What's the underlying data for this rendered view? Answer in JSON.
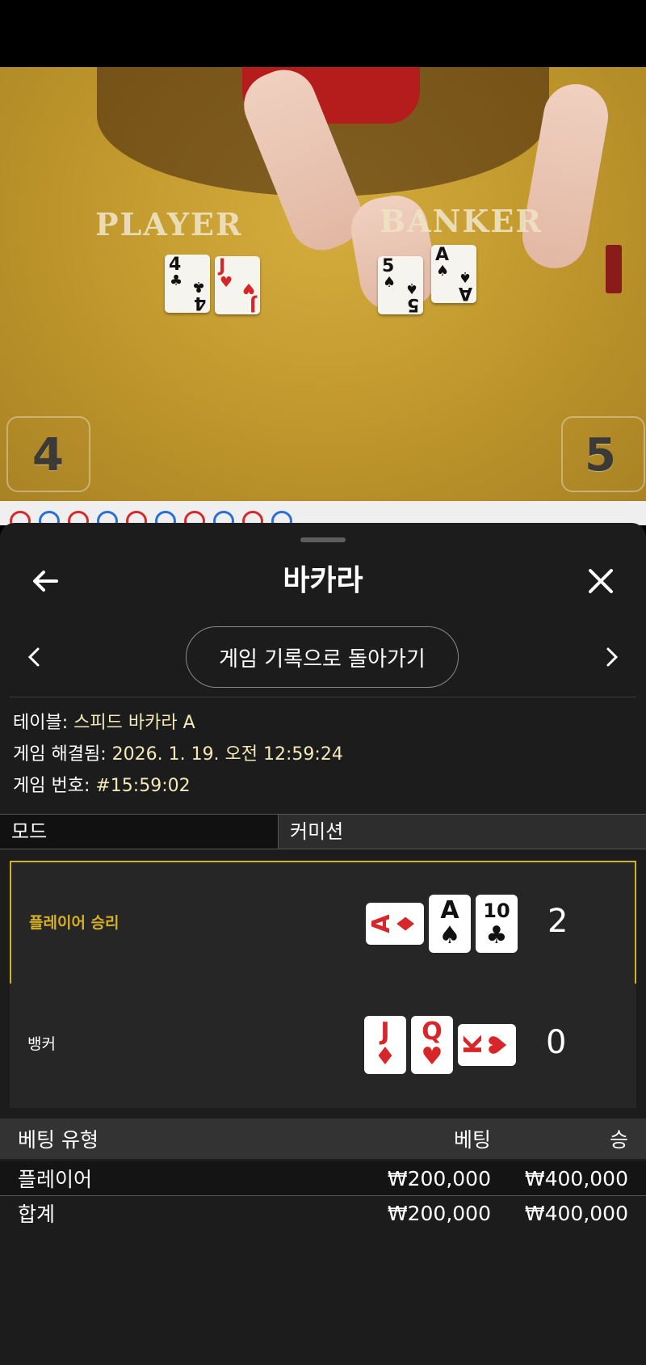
{
  "video": {
    "player_label": "PLAYER",
    "banker_label": "BANKER",
    "player_score": "4",
    "banker_score": "5",
    "player_cards": [
      {
        "rank": "4",
        "suit": "♣",
        "color": "black"
      },
      {
        "rank": "J",
        "suit": "♥",
        "color": "red"
      }
    ],
    "banker_cards": [
      {
        "rank": "5",
        "suit": "♠",
        "color": "black"
      },
      {
        "rank": "A",
        "suit": "♠",
        "color": "black"
      }
    ],
    "road": [
      "B",
      "P",
      "B",
      "P",
      "B",
      "P",
      "B",
      "P",
      "B",
      "P"
    ]
  },
  "sheet": {
    "title": "바카라",
    "back_icon": "arrow-left-icon",
    "close_icon": "close-icon",
    "back_to_history": "게임 기록으로 돌아가기",
    "info": {
      "table_label": "테이블: ",
      "table_value": "스피드 바카라 A",
      "resolved_label": "게임 해결됨: ",
      "resolved_value": "2026. 1. 19. 오전 12:59:24",
      "number_label": "게임 번호: ",
      "number_value": "#15:59:02"
    },
    "tabs": {
      "mode": "모드",
      "commission": "커미션"
    },
    "results": [
      {
        "label": "플레이어 승리",
        "winner": true,
        "score": "2",
        "cards": [
          {
            "rank": "A",
            "suit": "♦",
            "color": "red",
            "sideways": true
          },
          {
            "rank": "A",
            "suit": "♠",
            "color": "black",
            "sideways": false
          },
          {
            "rank": "10",
            "suit": "♣",
            "color": "black",
            "sideways": false
          }
        ]
      },
      {
        "label": "뱅커",
        "winner": false,
        "score": "0",
        "cards": [
          {
            "rank": "J",
            "suit": "♦",
            "color": "red",
            "sideways": false
          },
          {
            "rank": "Q",
            "suit": "♥",
            "color": "red",
            "sideways": false
          },
          {
            "rank": "K",
            "suit": "♥",
            "color": "red",
            "sideways": true
          }
        ]
      }
    ],
    "bets_table": {
      "headers": {
        "type": "베팅 유형",
        "bet": "베팅",
        "win": "승"
      },
      "rows": [
        {
          "type": "플레이어",
          "bet": "₩200,000",
          "win": "₩400,000"
        }
      ],
      "total": {
        "type": "합계",
        "bet": "₩200,000",
        "win": "₩400,000"
      }
    }
  },
  "colors": {
    "accent": "#d6b025",
    "value_text": "#f4e9b8",
    "card_red": "#d6262a",
    "road_player": "#2a6fd6",
    "road_banker": "#d62a2a"
  }
}
